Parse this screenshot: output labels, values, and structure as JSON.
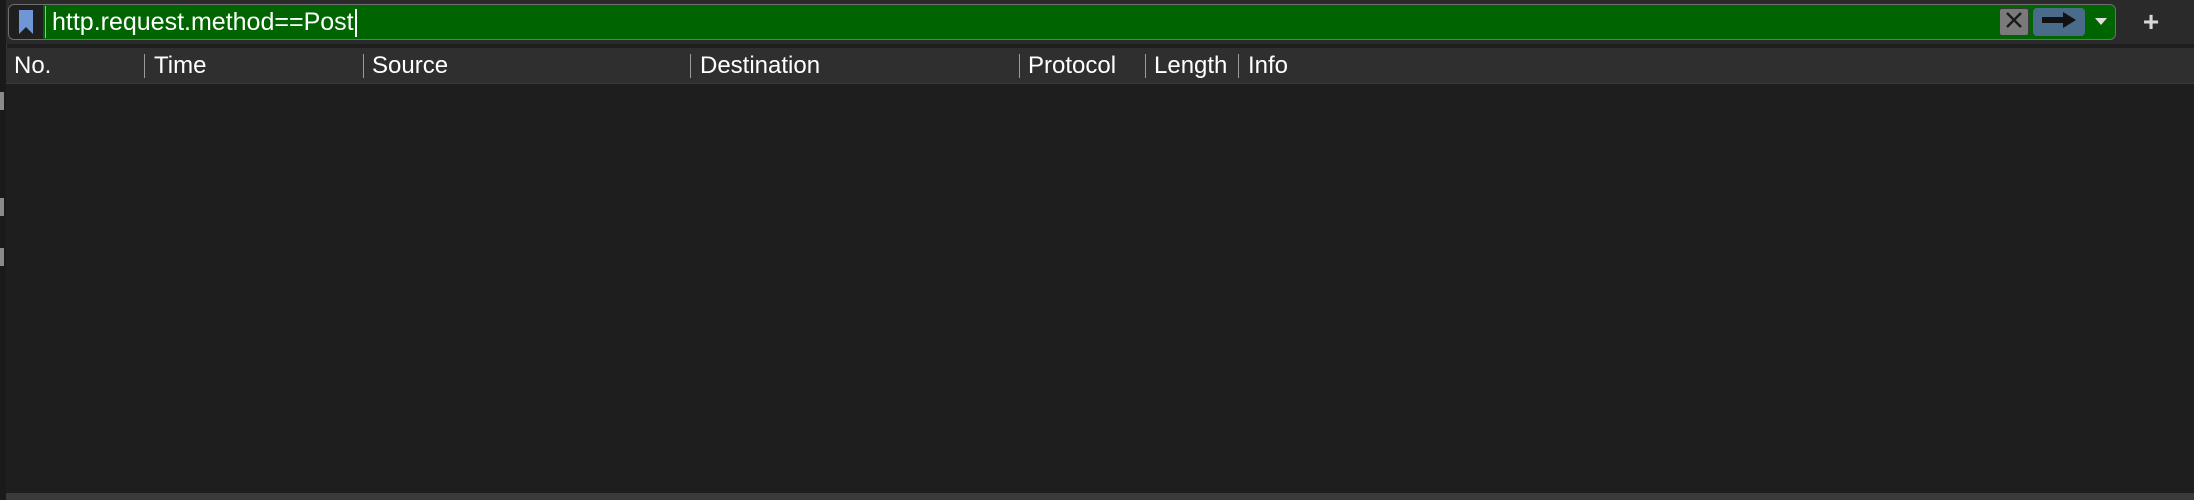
{
  "filter": {
    "value": "http.request.method==Post",
    "background": "#006400",
    "bookmark_icon": "bookmark-icon",
    "clear_icon": "close-icon",
    "apply_icon": "arrow-right-icon",
    "dropdown_icon": "chevron-down-icon",
    "add_label": "+"
  },
  "columns": [
    {
      "label": "No."
    },
    {
      "label": "Time"
    },
    {
      "label": "Source"
    },
    {
      "label": "Destination"
    },
    {
      "label": "Protocol"
    },
    {
      "label": "Length"
    },
    {
      "label": "Info"
    }
  ],
  "packets": []
}
